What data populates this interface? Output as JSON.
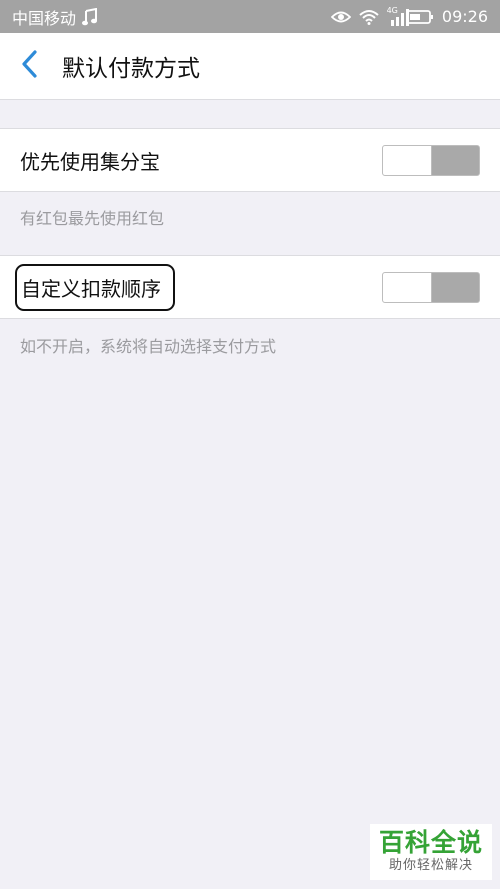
{
  "status_bar": {
    "carrier": "中国移动",
    "network": "4G",
    "time": "09:26"
  },
  "nav": {
    "title": "默认付款方式"
  },
  "settings": [
    {
      "label": "优先使用集分宝",
      "enabled": false,
      "hint": "有红包最先使用红包"
    },
    {
      "label": "自定义扣款顺序",
      "enabled": false,
      "hint": "如不开启，系统将自动选择支付方式"
    }
  ],
  "watermark": {
    "title": "百科全说",
    "subtitle": "助你轻松解决"
  },
  "colors": {
    "status_bar_bg": "#a3a3a3",
    "accent_back": "#2e8bd8",
    "page_bg": "#f1f0f6",
    "toggle_off": "#a9a9a9",
    "watermark_green": "#35a336"
  }
}
